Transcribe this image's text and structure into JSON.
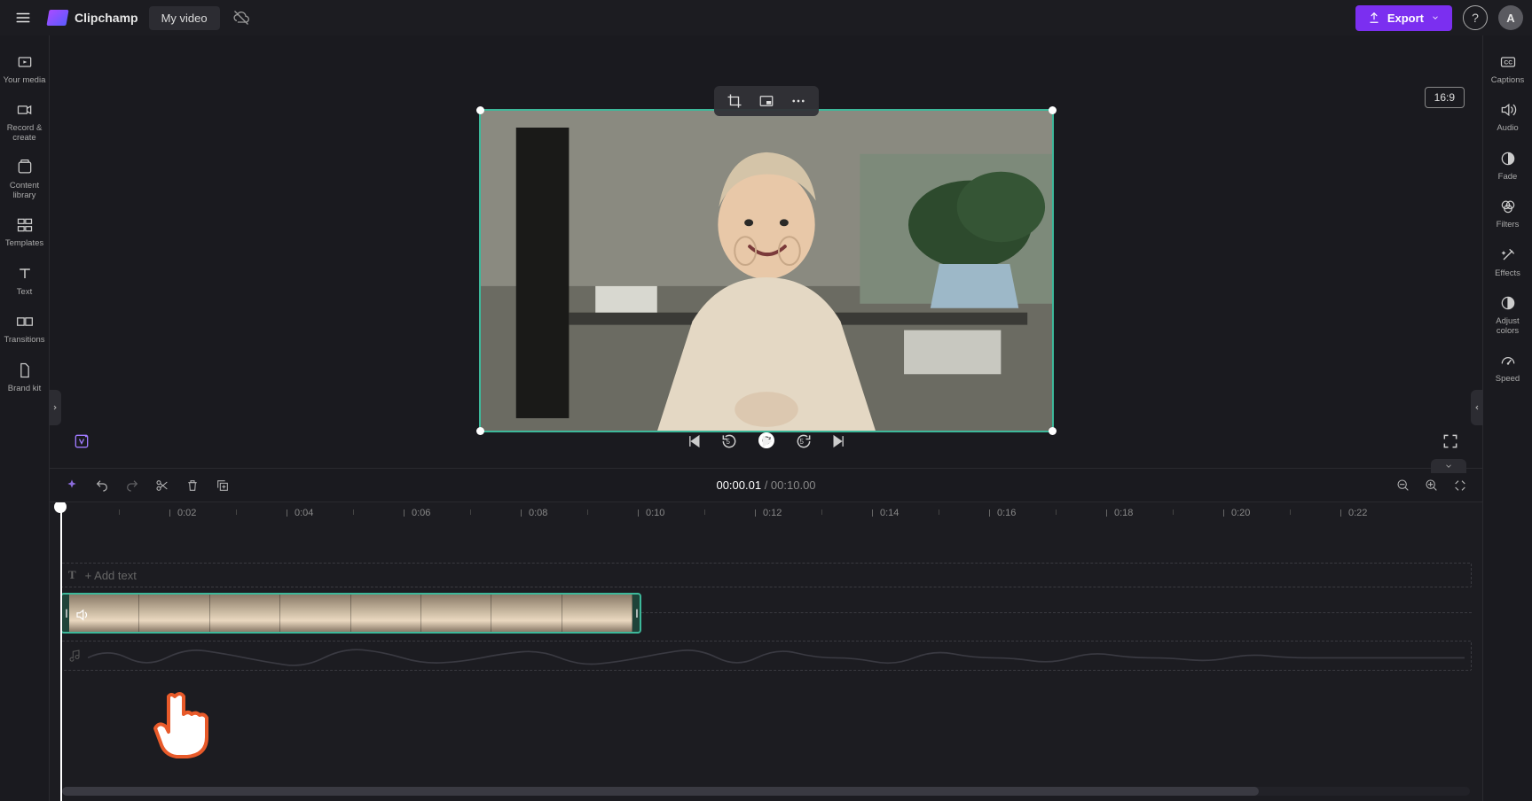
{
  "app": {
    "name": "Clipchamp"
  },
  "header": {
    "video_title": "My video",
    "export_label": "Export",
    "avatar_initial": "A",
    "aspect_ratio": "16:9"
  },
  "left_sidebar": {
    "items": [
      {
        "label": "Your media"
      },
      {
        "label": "Record & create"
      },
      {
        "label": "Content library"
      },
      {
        "label": "Templates"
      },
      {
        "label": "Text"
      },
      {
        "label": "Transitions"
      },
      {
        "label": "Brand kit"
      }
    ]
  },
  "right_sidebar": {
    "items": [
      {
        "label": "Captions"
      },
      {
        "label": "Audio"
      },
      {
        "label": "Fade"
      },
      {
        "label": "Filters"
      },
      {
        "label": "Effects"
      },
      {
        "label": "Adjust colors"
      },
      {
        "label": "Speed"
      }
    ]
  },
  "player": {
    "skip_seconds": "5"
  },
  "timeline": {
    "current_time": "00:00.01",
    "total_time": "00:10.00",
    "ruler_marks": [
      "0:02",
      "0:04",
      "0:06",
      "0:08",
      "0:10",
      "0:12",
      "0:14",
      "0:16",
      "0:18",
      "0:20",
      "0:22"
    ],
    "text_track_placeholder": "+ Add text"
  },
  "colors": {
    "accent": "#7b2ff0",
    "selection": "#3db89a"
  }
}
